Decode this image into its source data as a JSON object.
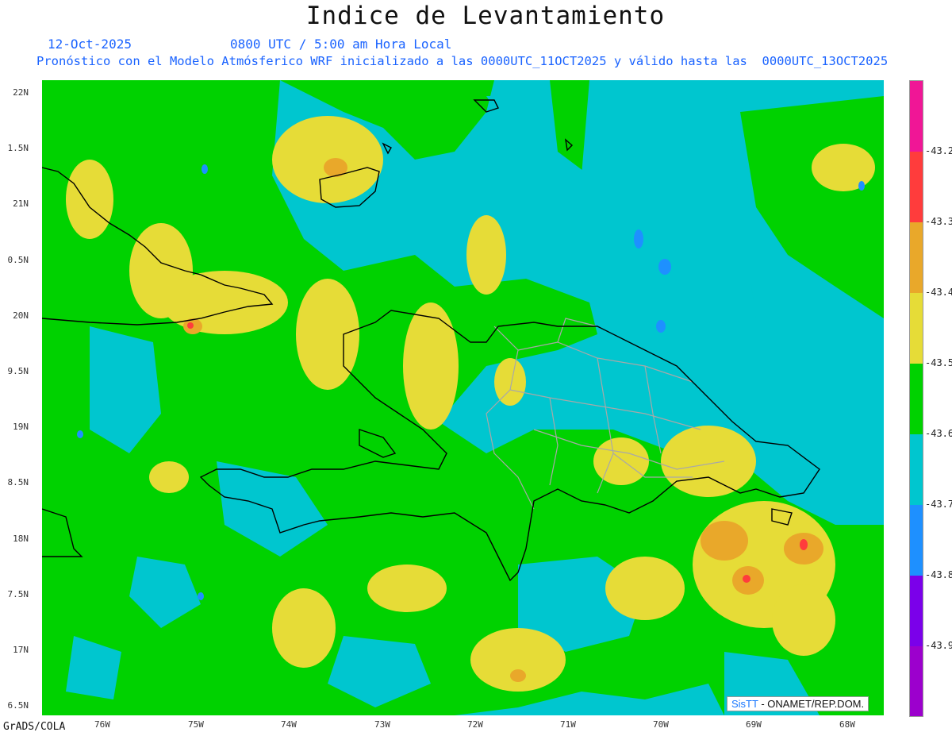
{
  "title": "Indice de Levantamiento",
  "subtitle": {
    "date": "12-Oct-2025",
    "time": "0800 UTC / 5:00 am Hora Local",
    "description": "Pronóstico con el Modelo Atmósferico WRF inicializado a las 0000UTC_11OCT2025 y válido hasta las  0000UTC_13OCT2025"
  },
  "axes": {
    "y_labels": [
      "22N",
      "1.5N",
      "21N",
      "0.5N",
      "20N",
      "9.5N",
      "19N",
      "8.5N",
      "18N",
      "7.5N",
      "17N",
      "6.5N"
    ],
    "x_labels": [
      "76W",
      "75W",
      "74W",
      "73W",
      "72W",
      "71W",
      "70W",
      "69W",
      "68W"
    ]
  },
  "legend": {
    "colors": [
      "#f01696",
      "#ff3c3c",
      "#e9a82a",
      "#e6dc37",
      "#00d200",
      "#00c6cf",
      "#1e90ff",
      "#7b00ea",
      "#9c00cd"
    ],
    "labels": [
      "-43.2",
      "-43.3",
      "-43.4",
      "-43.5",
      "-43.6",
      "-43.7",
      "-43.8",
      "-43.9"
    ]
  },
  "credit": {
    "brand": "SisTT",
    "text": "- ONAMET/REP.DOM."
  },
  "software": "GrADS/COLA",
  "colors": {
    "sea_cyan": "#00c6cf",
    "green": "#00d200",
    "yellow": "#e6dc37",
    "orange": "#e9a82a",
    "red": "#ff3c3c",
    "blue": "#1e90ff",
    "coast": "#000000",
    "provinces": "#a8a8a8"
  }
}
